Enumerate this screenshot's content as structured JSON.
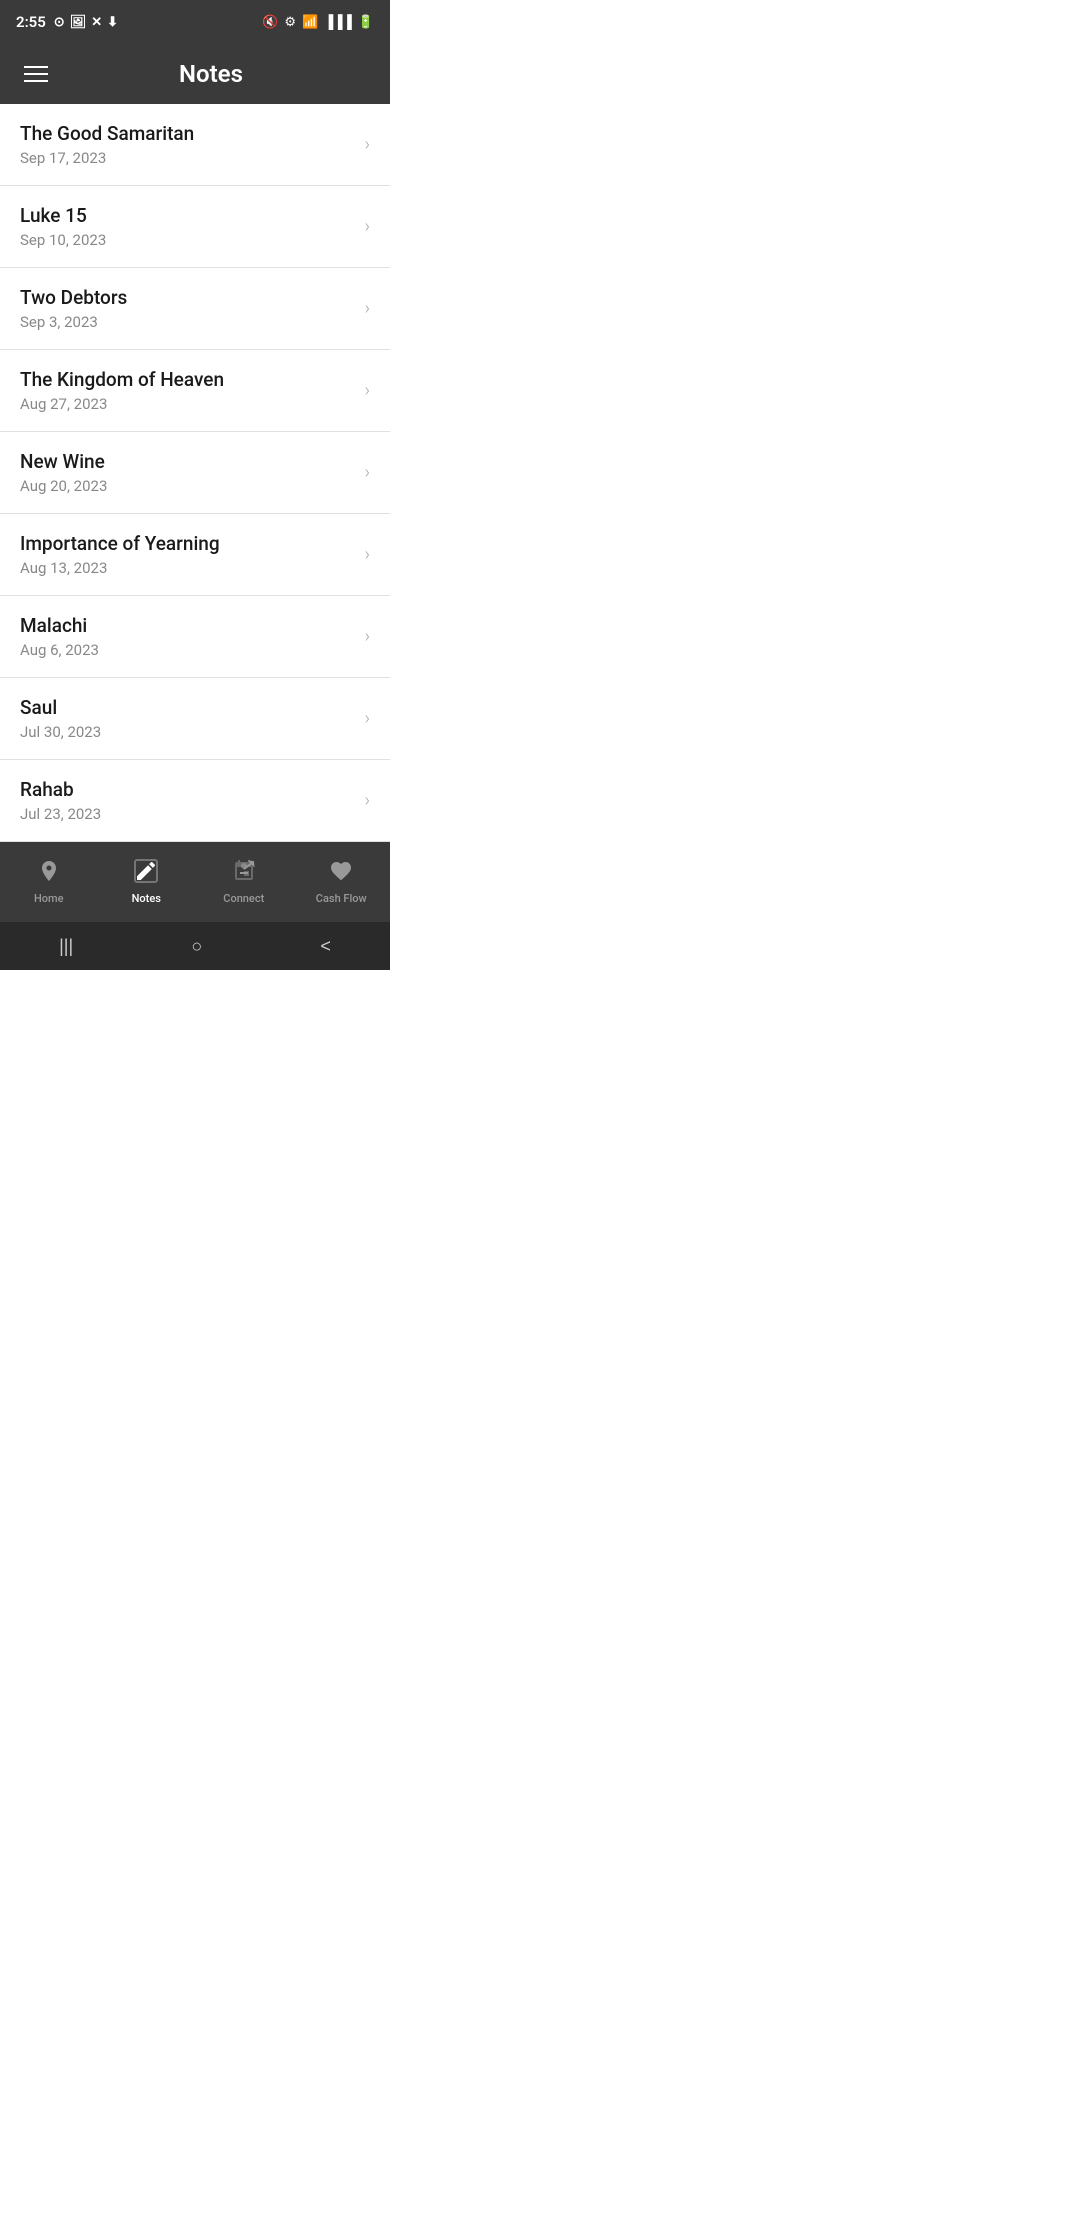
{
  "statusBar": {
    "time": "2:55",
    "leftIcons": [
      "⊙",
      "🖼",
      "✕",
      "⬇"
    ],
    "rightIcons": [
      "🔇",
      "⚙",
      "📶",
      "📶",
      "🔋"
    ]
  },
  "header": {
    "title": "Notes",
    "menuLabel": "menu"
  },
  "notes": [
    {
      "id": 1,
      "title": "The Good Samaritan",
      "date": "Sep 17, 2023"
    },
    {
      "id": 2,
      "title": "Luke 15",
      "date": "Sep 10, 2023"
    },
    {
      "id": 3,
      "title": "Two Debtors",
      "date": "Sep 3, 2023"
    },
    {
      "id": 4,
      "title": "The Kingdom of Heaven",
      "date": "Aug 27, 2023"
    },
    {
      "id": 5,
      "title": "New Wine",
      "date": "Aug 20, 2023"
    },
    {
      "id": 6,
      "title": "Importance of Yearning",
      "date": "Aug 13, 2023"
    },
    {
      "id": 7,
      "title": "Malachi",
      "date": "Aug 6, 2023"
    },
    {
      "id": 8,
      "title": "Saul",
      "date": "Jul 30, 2023"
    },
    {
      "id": 9,
      "title": "Rahab",
      "date": "Jul 23, 2023"
    }
  ],
  "bottomNav": {
    "items": [
      {
        "id": "home",
        "label": "Home",
        "icon": "📍",
        "active": false
      },
      {
        "id": "notes",
        "label": "Notes",
        "icon": "📝",
        "active": true
      },
      {
        "id": "connect",
        "label": "Connect",
        "icon": "📌",
        "active": false
      },
      {
        "id": "cashflow",
        "label": "Cash Flow",
        "icon": "♥",
        "active": false
      }
    ]
  },
  "systemNav": {
    "buttons": [
      "|||",
      "○",
      "<"
    ]
  }
}
